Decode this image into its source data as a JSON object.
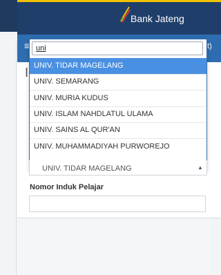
{
  "brand": {
    "name": "Bank Jateng",
    "colors": {
      "brand_bar": "#1f3f6a",
      "nav": "#2e6db0",
      "accent": "#f2c200",
      "highlight": "#4a90e2"
    }
  },
  "nav": {
    "menu_icon": "≡",
    "right_fragment": "t)"
  },
  "page": {
    "heading_fragment": "II"
  },
  "dropdown": {
    "search_value": "uni",
    "options": [
      {
        "label": "UNIV. TIDAR MAGELANG",
        "highlighted": true
      },
      {
        "label": "UNIV. SEMARANG",
        "highlighted": false
      },
      {
        "label": "UNIV. MURIA KUDUS",
        "highlighted": false
      },
      {
        "label": "UNIV. ISLAM NAHDLATUL ULAMA",
        "highlighted": false
      },
      {
        "label": "UNIV. SAINS AL QUR'AN",
        "highlighted": false
      },
      {
        "label": "UNIV. MUHAMMADIYAH PURWOREJO",
        "highlighted": false
      }
    ]
  },
  "select": {
    "selected_value": "UNIV. TIDAR MAGELANG",
    "arrow_glyph": "▲"
  },
  "form": {
    "nis_label": "Nomor Induk Pelajar",
    "nis_value": ""
  }
}
